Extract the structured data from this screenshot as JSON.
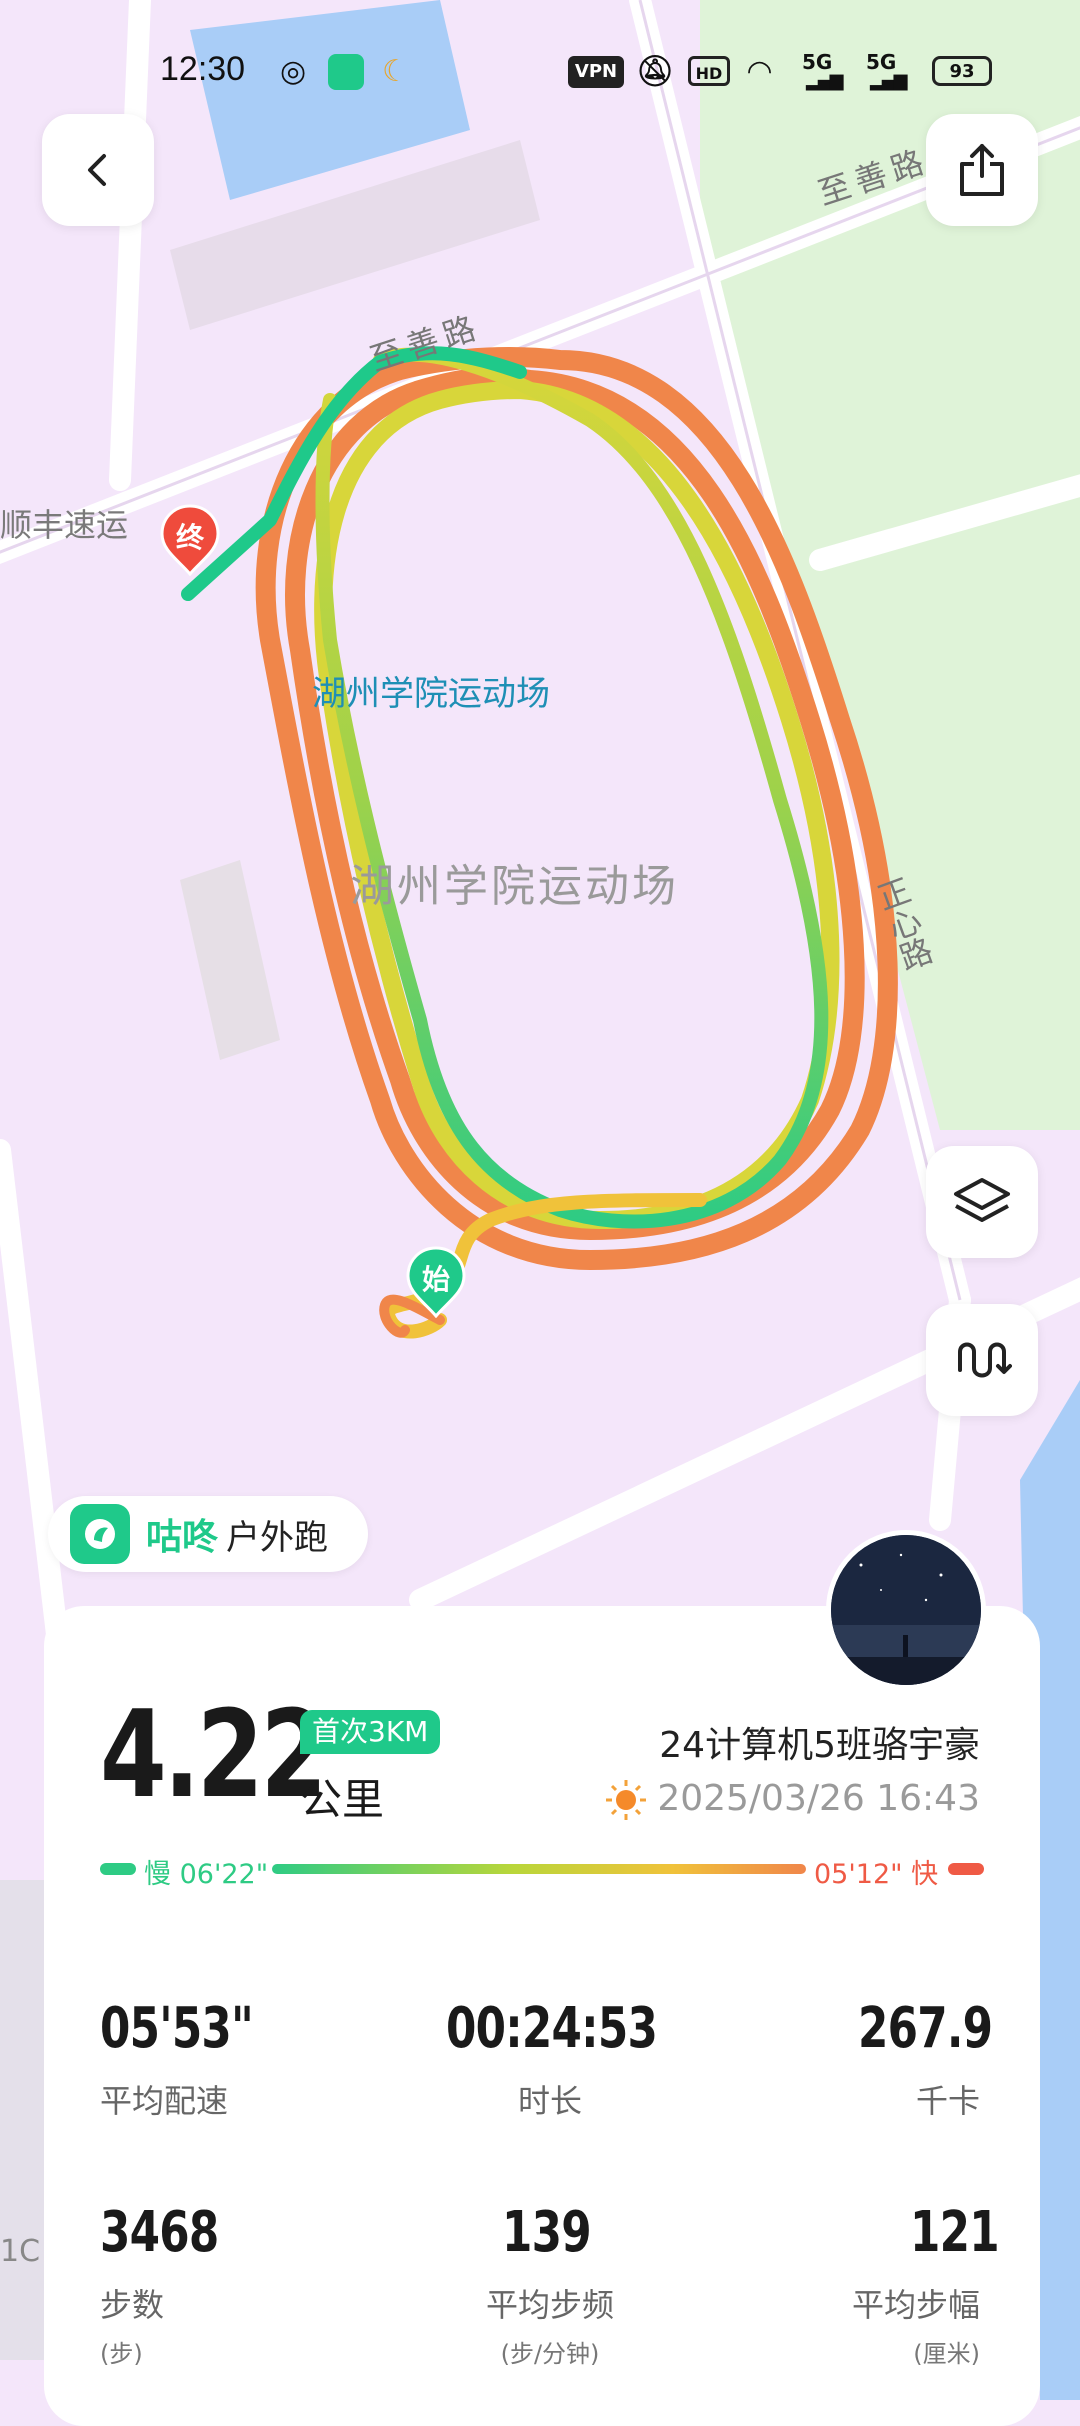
{
  "status_bar": {
    "time": "12:30",
    "vpn": "VPN",
    "hd": "HD",
    "network1": "5G",
    "network2": "5G",
    "battery": "93"
  },
  "map": {
    "road_top_right": "至善路",
    "road_top_left": "至善路",
    "road_right": "正心路",
    "road_top_vertical": "正心路",
    "poi_shunfeng": "顺丰速运",
    "stadium_label_blue": "湖州学院运动场",
    "stadium_label_gray": "湖州学院运动场",
    "end_marker": "终",
    "start_marker": "始",
    "edge_label": "1C"
  },
  "brand": {
    "name": "咕咚",
    "mode": "户外跑"
  },
  "summary": {
    "distance": "4.22",
    "distance_unit": "公里",
    "badge": "首次3KM",
    "user_name": "24计算机5班骆宇豪",
    "datetime": "2025/03/26 16:43",
    "pace_slow": "慢 06'22\"",
    "pace_fast": "05'12\" 快"
  },
  "stats": [
    {
      "value": "05'53\"",
      "label": "平均配速",
      "unit": ""
    },
    {
      "value": "00:24:53",
      "label": "时长",
      "unit": ""
    },
    {
      "value": "267.9",
      "label": "千卡",
      "unit": ""
    },
    {
      "value": "3468",
      "label": "步数",
      "unit": "(步)"
    },
    {
      "value": "139",
      "label": "平均步频",
      "unit": "(步/分钟)"
    },
    {
      "value": "121",
      "label": "平均步幅",
      "unit": "(厘米)"
    }
  ],
  "colors": {
    "accent_green": "#1fc98a",
    "orange": "#f0864a",
    "yellow": "#e9d23a",
    "fast_red": "#ef5a45"
  }
}
